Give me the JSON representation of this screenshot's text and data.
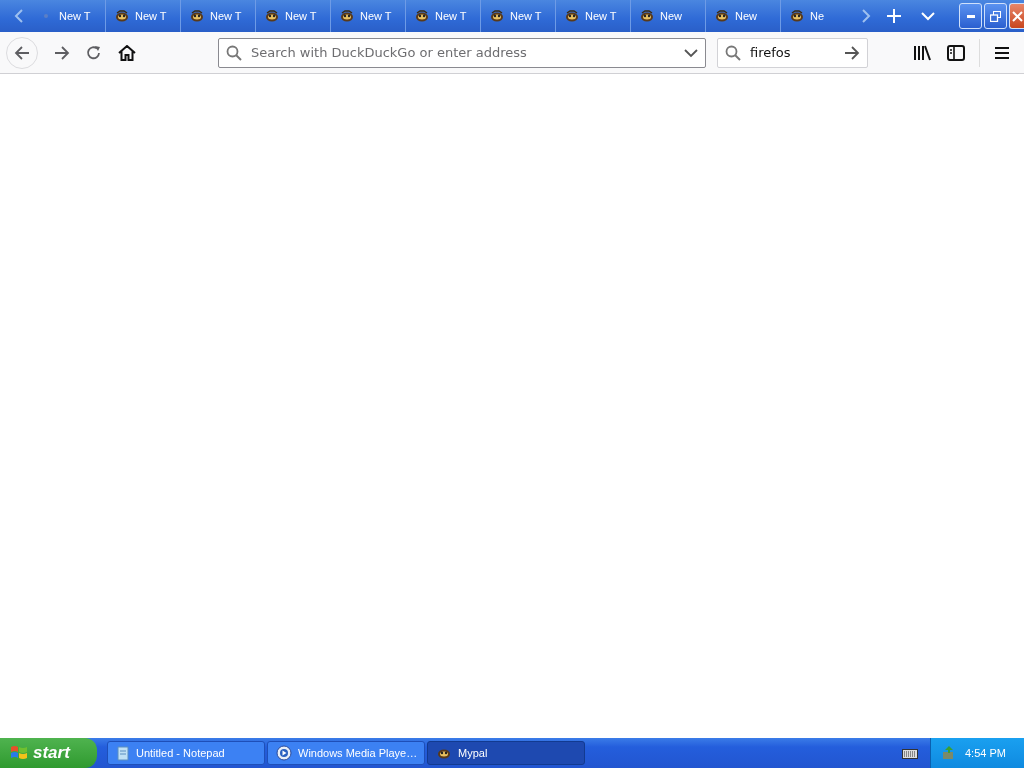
{
  "tabs": [
    {
      "label": "New T",
      "kind": "loading"
    },
    {
      "label": "New T",
      "kind": "page"
    },
    {
      "label": "New T",
      "kind": "page"
    },
    {
      "label": "New T",
      "kind": "page"
    },
    {
      "label": "New T",
      "kind": "page"
    },
    {
      "label": "New T",
      "kind": "page"
    },
    {
      "label": "New T",
      "kind": "page"
    },
    {
      "label": "New T",
      "kind": "page"
    },
    {
      "label": "New",
      "kind": "page"
    },
    {
      "label": "New",
      "kind": "page"
    },
    {
      "label": "Ne",
      "kind": "page"
    }
  ],
  "address_bar": {
    "placeholder": "Search with DuckDuckGo or enter address"
  },
  "search_bar": {
    "value": "firefos"
  },
  "taskbar": {
    "start": "start",
    "tasks": [
      {
        "label": "Untitled - Notepad",
        "kind": "notepad",
        "selected": false
      },
      {
        "label": "Windows Media Playe…",
        "kind": "media",
        "selected": false
      },
      {
        "label": "Mypal",
        "kind": "browser",
        "selected": true
      }
    ],
    "clock": "4:54 PM"
  }
}
